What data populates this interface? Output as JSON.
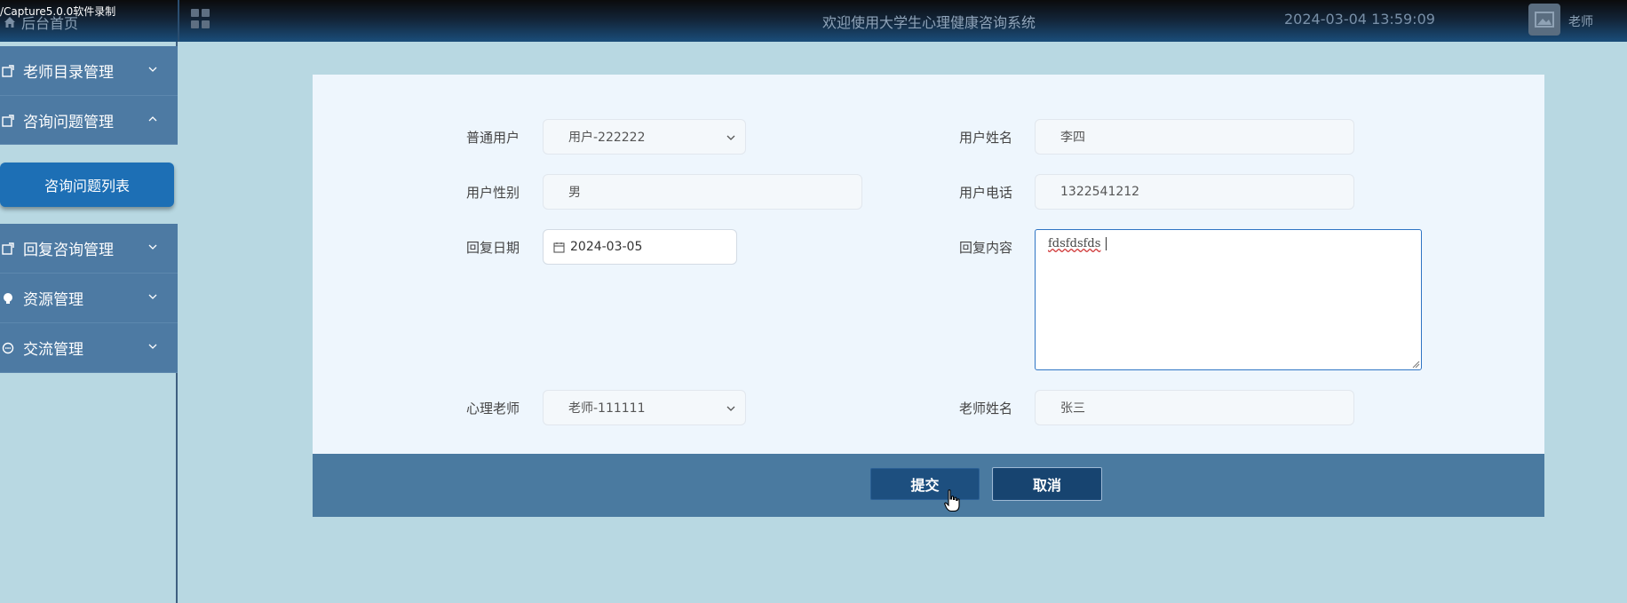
{
  "watermark": "/Capture5.0.0软件录制",
  "header": {
    "home_label": "后台首页",
    "system_title": "欢迎使用大学生心理健康咨询系统",
    "datetime": "2024-03-04 13:59:09",
    "user_name": "老师"
  },
  "sidebar": {
    "groups": [
      {
        "label": "老师目录管理",
        "icon": "edit-icon",
        "expanded": false
      },
      {
        "label": "咨询问题管理",
        "icon": "edit-icon",
        "expanded": true
      },
      {
        "label": "回复咨询管理",
        "icon": "edit-icon",
        "expanded": false
      },
      {
        "label": "资源管理",
        "icon": "bulb-icon",
        "expanded": false
      },
      {
        "label": "交流管理",
        "icon": "chat-icon",
        "expanded": false
      }
    ],
    "active_sub_item": "咨询问题列表"
  },
  "form": {
    "user_label": "普通用户",
    "user_value": "用户-222222",
    "username_label": "用户姓名",
    "username_value": "李四",
    "gender_label": "用户性别",
    "gender_value": "男",
    "phone_label": "用户电话",
    "phone_value": "1322541212",
    "reply_date_label": "回复日期",
    "reply_date_value": "2024-03-05",
    "reply_content_label": "回复内容",
    "reply_content_value": "fdsfdsfds",
    "teacher_label": "心理老师",
    "teacher_value": "老师-111111",
    "teacher_name_label": "老师姓名",
    "teacher_name_value": "张三"
  },
  "actions": {
    "submit_label": "提交",
    "cancel_label": "取消"
  },
  "colors": {
    "accent": "#1d6fb5",
    "sidebar_group": "#4d7aa3",
    "background": "#b8d8e2",
    "button": "#1d4f7f"
  }
}
